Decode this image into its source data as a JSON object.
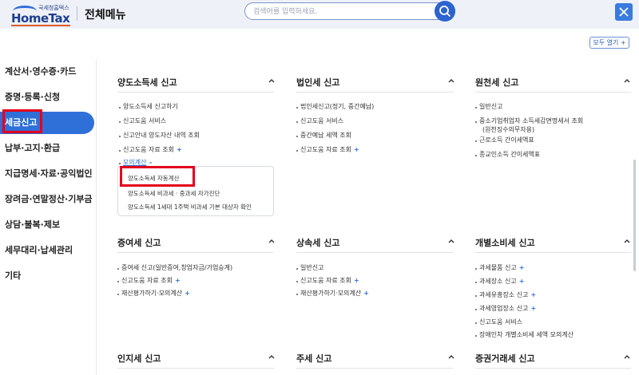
{
  "header": {
    "logo_sub": "국세청홈택스",
    "logo_main": "HomeTax",
    "title": "전체메뉴",
    "search_placeholder": "검색어를 입력하세요."
  },
  "expand_all": "모두 열기 +",
  "sidebar": {
    "items": [
      {
        "label": "계산서·영수증·카드"
      },
      {
        "label": "증명·등록·신청"
      },
      {
        "label": "세금신고"
      },
      {
        "label": "납부·고지·환급"
      },
      {
        "label": "지급명세·자료·공익법인"
      },
      {
        "label": "장려금·연말정산·기부금"
      },
      {
        "label": "상담·불복·제보"
      },
      {
        "label": "세무대리·납세관리"
      },
      {
        "label": "기타"
      }
    ]
  },
  "sections": {
    "yangdo": {
      "title": "양도소득세 신고",
      "items": [
        "양도소득세 신고하기",
        "신고도움 서비스",
        "신고안내 양도자산 내역 조회",
        "신고도움 자료 조회",
        "모의계산"
      ],
      "sub": [
        "양도소득세 자동계산",
        "양도소득세 비과세 · 중과세 자가진단",
        "양도소득세 1세대 1주택 비과세 기본 대상자 확인"
      ]
    },
    "corp": {
      "title": "법인세 신고",
      "items": [
        "법인세신고(정기, 중간예납)",
        "신고도움 서비스",
        "중간예납 세액 조회",
        "신고도움 자료 조회"
      ]
    },
    "withhold": {
      "title": "원천세 신고",
      "items": [
        "일반신고",
        "중소기업취업자 소득세감면명세서 조회",
        "(원천징수의무자용)",
        "근로소득 간이세액표",
        "종교인소득 간이세액표"
      ]
    },
    "gift": {
      "title": "증여세 신고",
      "items": [
        "증여세 신고(일반증여,창업자금/가업승계)",
        "신고도움 자료 조회",
        "재산평가하기·모의계산"
      ]
    },
    "inherit": {
      "title": "상속세 신고",
      "items": [
        "일반신고",
        "신고도움 자료 조회",
        "재산평가하기·모의계산"
      ]
    },
    "excise": {
      "title": "개별소비세 신고",
      "items": [
        "과세물품 신고",
        "과세장소 신고",
        "과세유흥장소 신고",
        "과세영업장소 신고",
        "신고도움 서비스",
        "장애인차 개별소비세 세액 모의계산"
      ]
    },
    "stamp": {
      "title": "인지세 신고"
    },
    "liquor": {
      "title": "주세 신고"
    },
    "securities": {
      "title": "증권거래세 신고"
    }
  }
}
